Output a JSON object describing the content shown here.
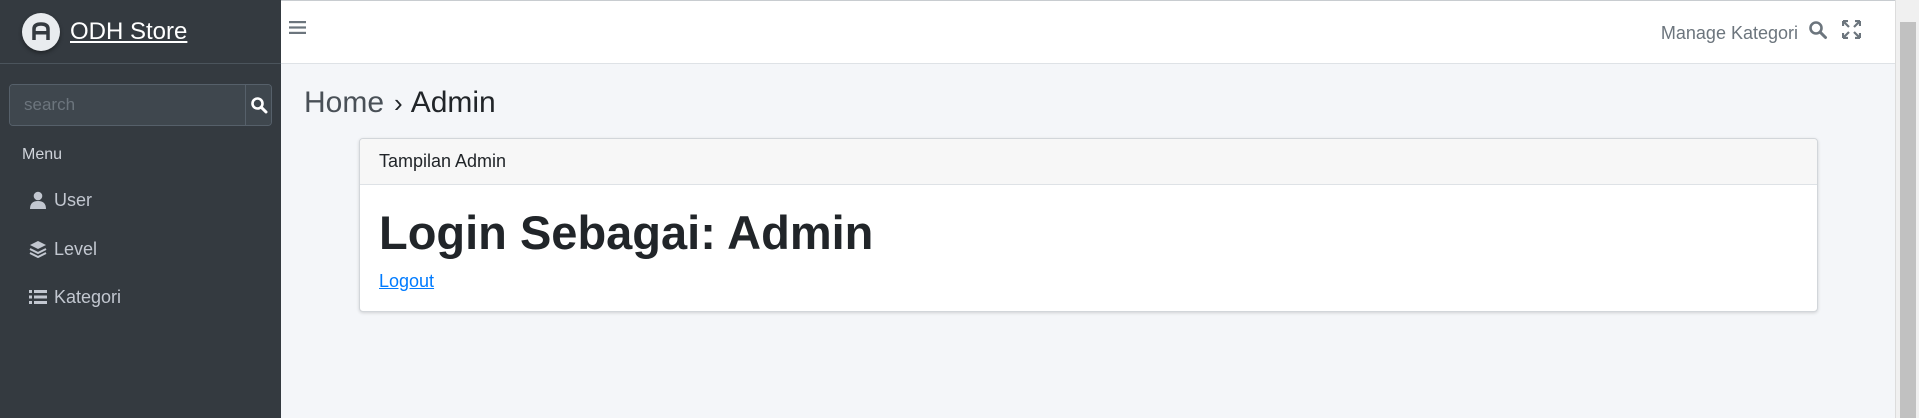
{
  "brand": {
    "name": "ODH Store"
  },
  "sidebar": {
    "search_placeholder": "search",
    "menu_header": "Menu",
    "items": [
      {
        "label": "User",
        "icon": "user-icon"
      },
      {
        "label": "Level",
        "icon": "layers-icon"
      },
      {
        "label": "Kategori",
        "icon": "list-icon"
      }
    ]
  },
  "topbar": {
    "link": "Manage Kategori"
  },
  "breadcrumb": {
    "home": "Home",
    "separator": "›",
    "current": "Admin"
  },
  "card": {
    "header": "Tampilan Admin",
    "title": "Login Sebagai: Admin",
    "link": "Logout"
  },
  "colors": {
    "sidebar": "#343a40",
    "content_bg": "#f4f6f9",
    "link": "#007bff"
  }
}
